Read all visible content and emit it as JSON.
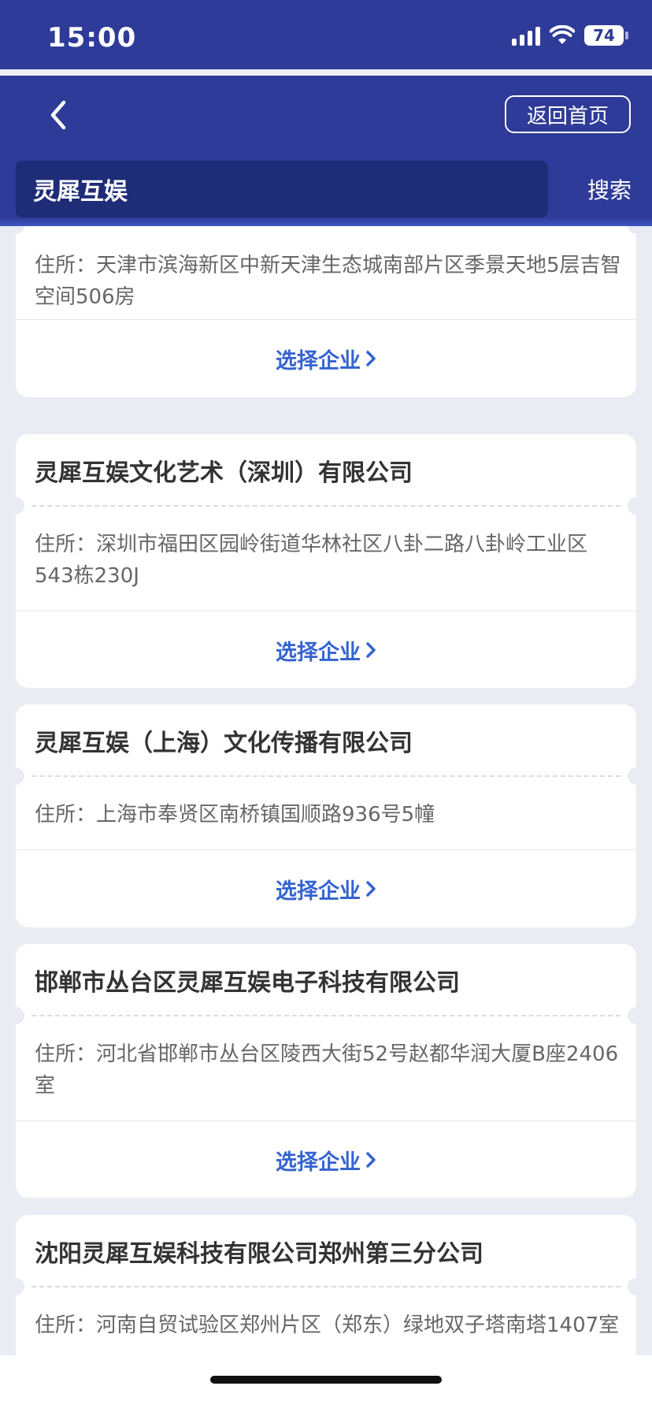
{
  "status_bar": {
    "time": "15:00",
    "battery": "74",
    "icons": [
      "signal-icon",
      "wifi-icon",
      "battery-icon"
    ]
  },
  "nav": {
    "back_icon": "chevron-left-icon",
    "home_label": "返回首页"
  },
  "search": {
    "value": "灵犀互娱",
    "button_label": "搜索"
  },
  "results": {
    "address_label": "住所：",
    "select_label": "选择企业",
    "items": [
      {
        "name": "",
        "address": "天津市滨海新区中新天津生态城南部片区季景天地5层吉智空间506房"
      },
      {
        "name": "灵犀互娱文化艺术（深圳）有限公司",
        "address": "深圳市福田区园岭街道华林社区八卦二路八卦岭工业区543栋230J"
      },
      {
        "name": "灵犀互娱（上海）文化传播有限公司",
        "address": "上海市奉贤区南桥镇国顺路936号5幢"
      },
      {
        "name": "邯郸市丛台区灵犀互娱电子科技有限公司",
        "address": "河北省邯郸市丛台区陵西大街52号赵都华润大厦B座2406室"
      },
      {
        "name": "沈阳灵犀互娱科技有限公司郑州第三分公司",
        "address": "河南自贸试验区郑州片区（郑东）绿地双子塔南塔1407室"
      }
    ]
  },
  "colors": {
    "header_bg": "#2e3b98",
    "search_bg": "#1f2c78",
    "accent": "#3563d1",
    "page_bg": "#e9ecf2"
  }
}
